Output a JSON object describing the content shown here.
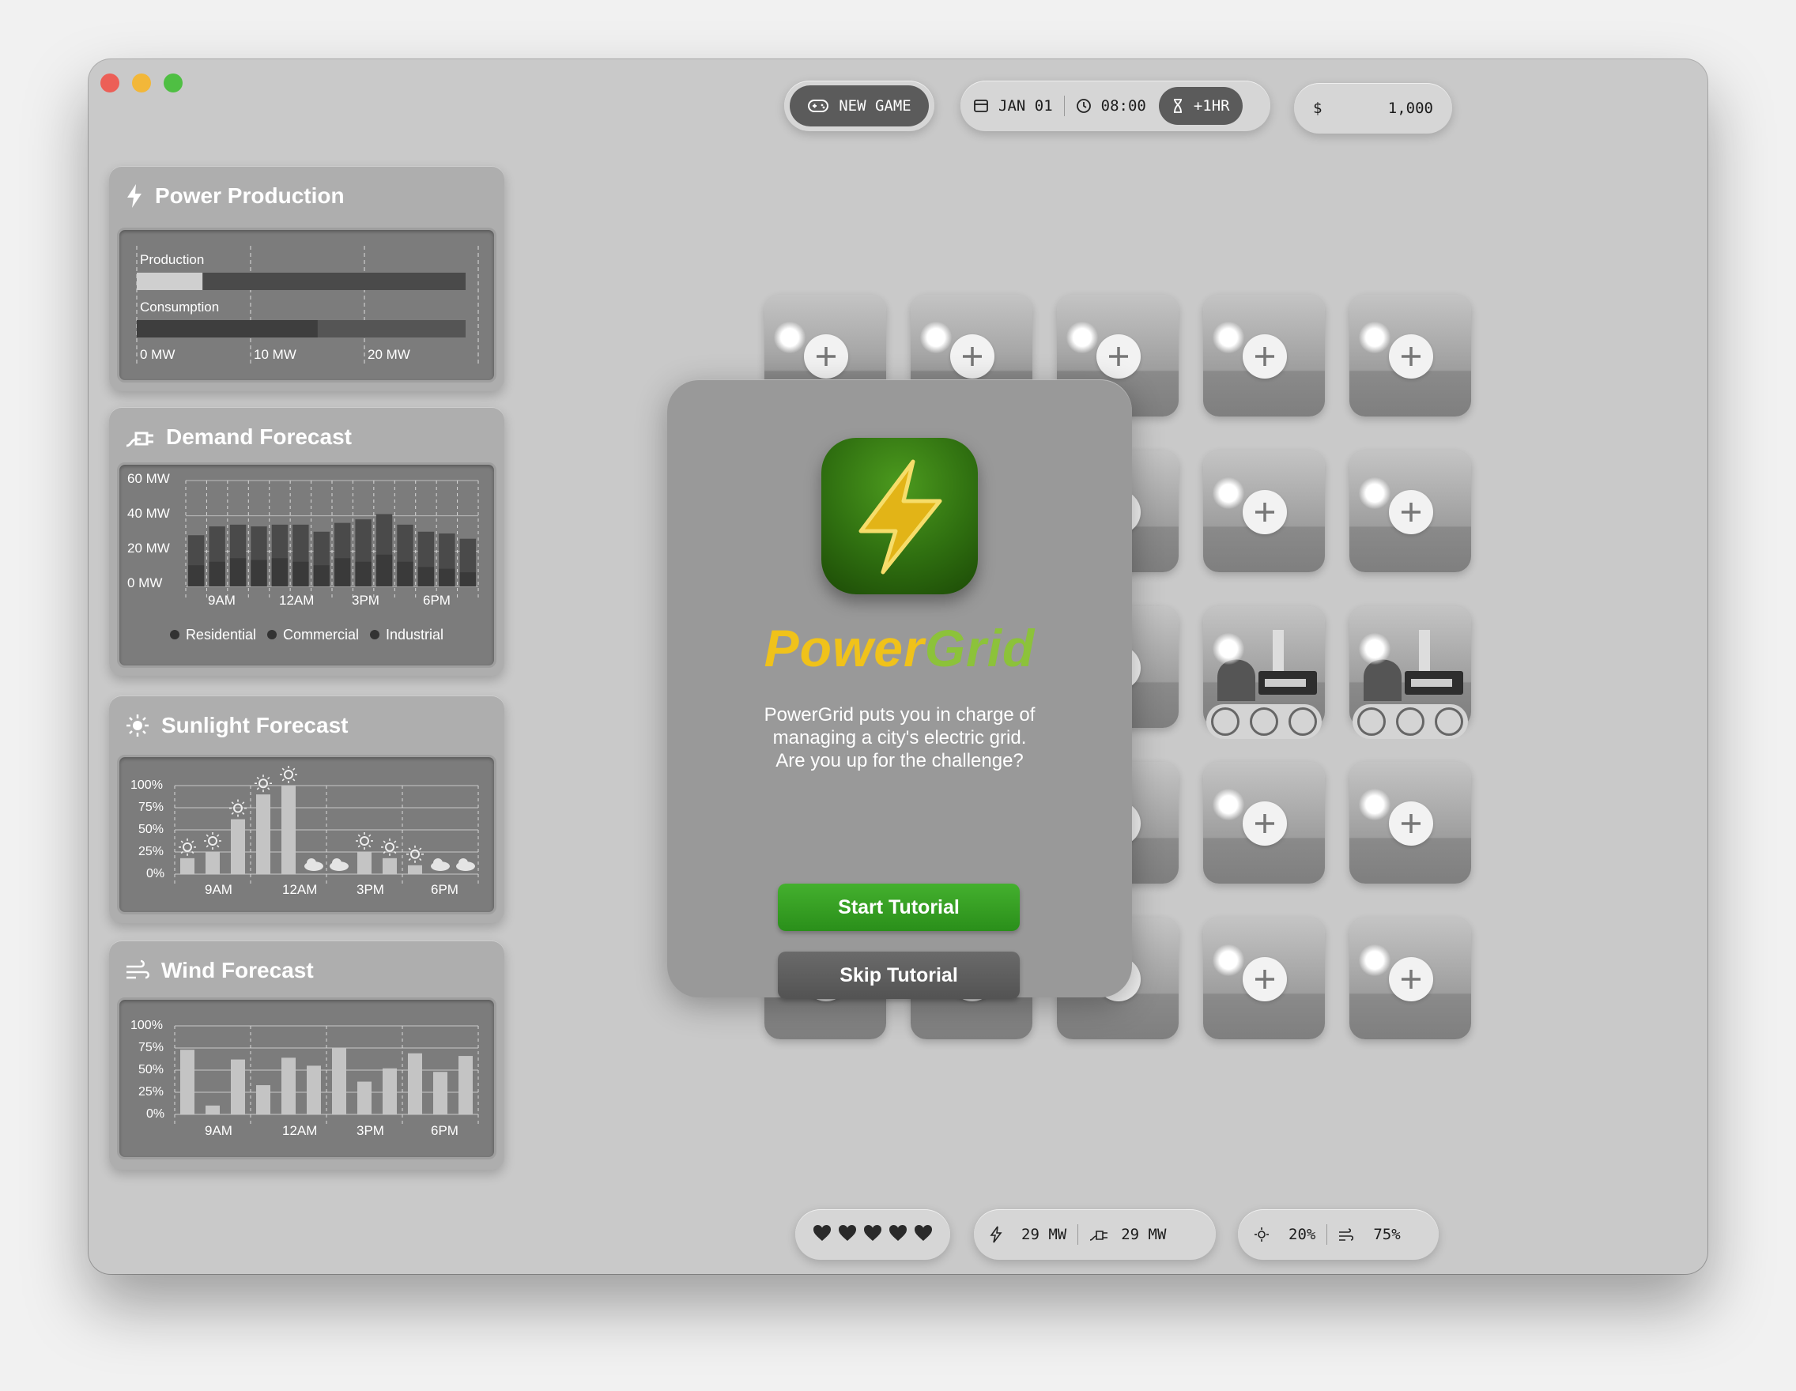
{
  "toolbar": {
    "new_game_label": "NEW GAME",
    "date": "JAN 01",
    "time": "08:00",
    "advance_label": "+1HR",
    "currency_symbol": "$",
    "money": "1,000"
  },
  "panels": {
    "power_production": {
      "title": "Power Production",
      "production_label": "Production",
      "consumption_label": "Consumption",
      "axis_ticks": [
        "0 MW",
        "10 MW",
        "20 MW"
      ],
      "production_fraction": 0.2,
      "consumption_fraction": 0.55
    },
    "demand_forecast": {
      "title": "Demand Forecast",
      "y_ticks": [
        "60 MW",
        "40 MW",
        "20 MW",
        "0 MW"
      ],
      "x_ticks": [
        "9AM",
        "12AM",
        "3PM",
        "6PM"
      ],
      "legend": [
        "Residential",
        "Commercial",
        "Industrial"
      ]
    },
    "sunlight_forecast": {
      "title": "Sunlight Forecast",
      "y_ticks": [
        "100%",
        "75%",
        "50%",
        "25%",
        "0%"
      ],
      "x_ticks": [
        "9AM",
        "12AM",
        "3PM",
        "6PM"
      ]
    },
    "wind_forecast": {
      "title": "Wind Forecast",
      "y_ticks": [
        "100%",
        "75%",
        "50%",
        "25%",
        "0%"
      ],
      "x_ticks": [
        "9AM",
        "12AM",
        "3PM",
        "6PM"
      ]
    }
  },
  "chart_data": [
    {
      "type": "bar",
      "title": "Demand Forecast",
      "ylim": [
        0,
        60
      ],
      "series": [
        {
          "name": "Residential",
          "values": [
            12,
            14,
            16,
            15,
            16,
            14,
            12,
            16,
            14,
            18,
            14,
            11,
            10,
            8
          ]
        },
        {
          "name": "Commercial",
          "values": [
            16,
            18,
            18,
            18,
            18,
            18,
            14,
            18,
            18,
            20,
            18,
            16,
            14,
            12
          ]
        },
        {
          "name": "Industrial",
          "values": [
            0,
            0,
            0,
            0,
            0,
            0,
            0,
            0,
            0,
            0,
            0,
            0,
            0,
            0
          ]
        }
      ],
      "totals": [
        29,
        34,
        35,
        34,
        35,
        35,
        31,
        36,
        38,
        41,
        35,
        31,
        30,
        27
      ]
    },
    {
      "type": "bar",
      "title": "Sunlight Forecast",
      "ylim": [
        0,
        100
      ],
      "values": [
        18,
        25,
        62,
        90,
        100,
        0,
        0,
        25,
        18,
        10,
        0,
        0
      ],
      "weather": [
        "sun",
        "sun",
        "sun",
        "sun",
        "sun",
        "cloud",
        "cloud",
        "sun",
        "sun",
        "sun",
        "cloud",
        "cloud"
      ]
    },
    {
      "type": "bar",
      "title": "Wind Forecast",
      "ylim": [
        0,
        100
      ],
      "values": [
        73,
        10,
        62,
        33,
        64,
        55,
        75,
        37,
        52,
        69,
        48,
        66
      ]
    }
  ],
  "modal": {
    "title_part1": "Power",
    "title_part2": "Grid",
    "description": "PowerGrid puts you in charge of\nmanaging a city's electric grid.\nAre you up for the challenge?",
    "start_label": "Start Tutorial",
    "skip_label": "Skip Tutorial"
  },
  "status": {
    "hearts": 5,
    "production": "29 MW",
    "demand": "29 MW",
    "sunlight": "20%",
    "wind": "75%"
  }
}
